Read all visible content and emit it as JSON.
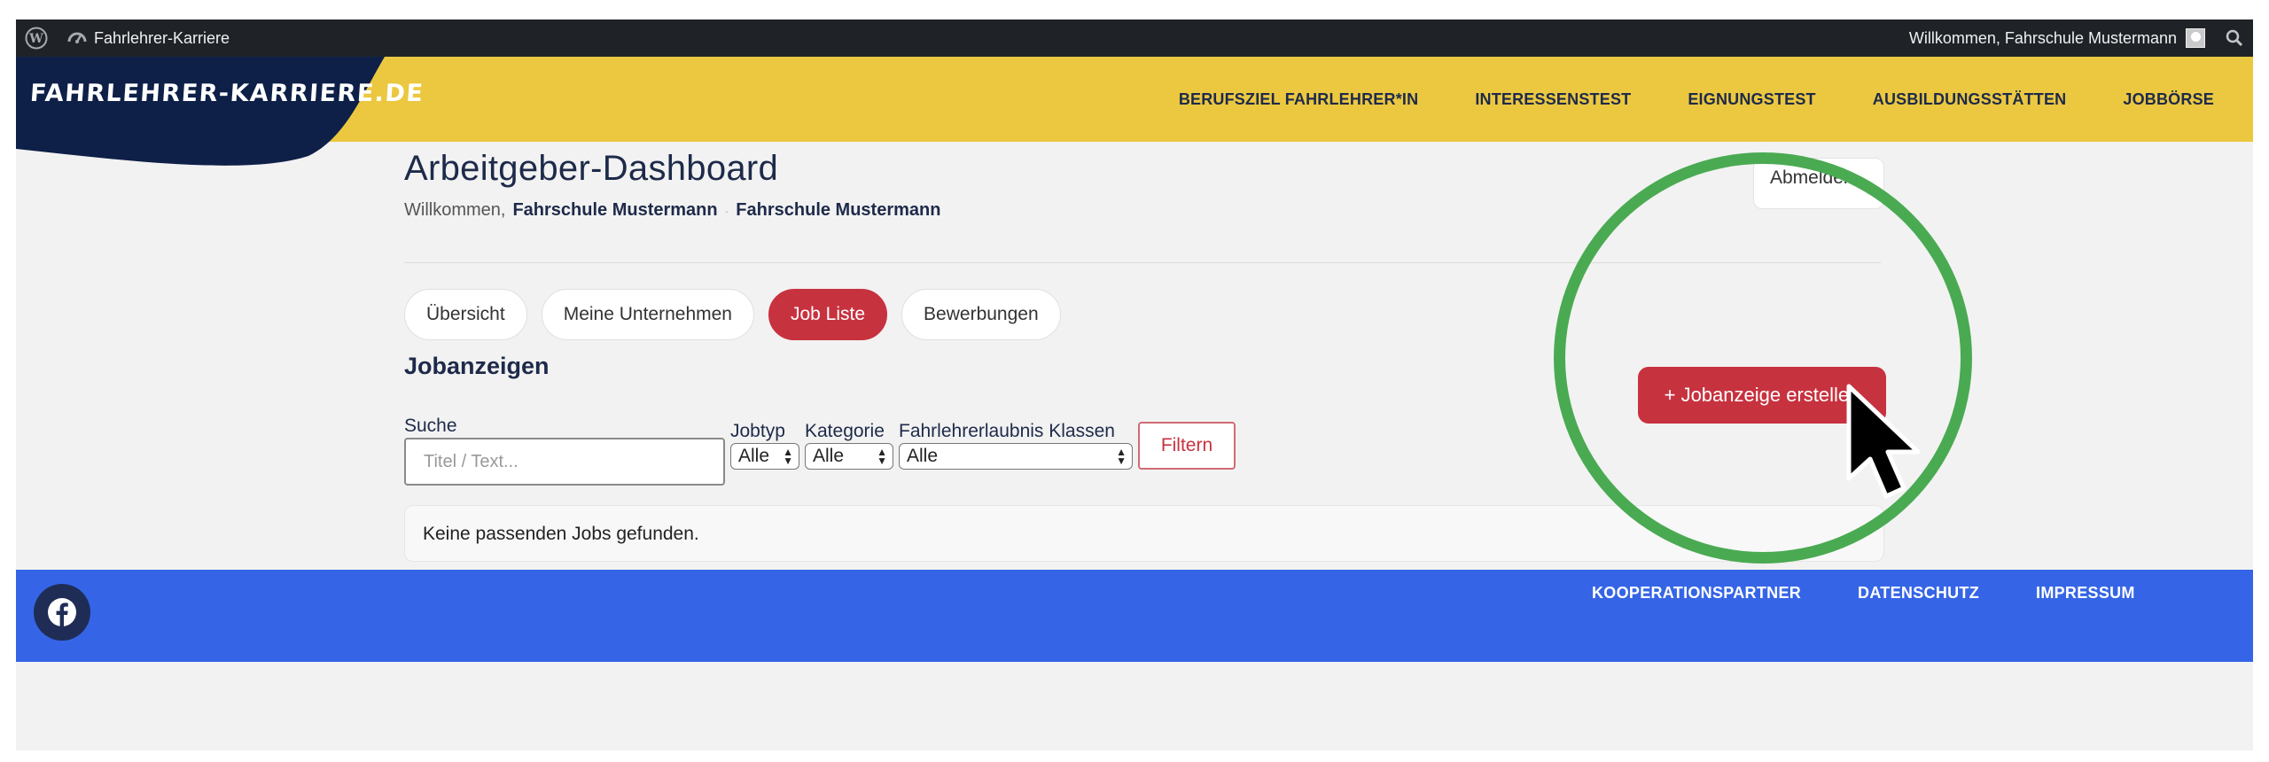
{
  "adminbar": {
    "site_name": "Fahrlehrer-Karriere",
    "greeting": "Willkommen, Fahrschule Mustermann"
  },
  "header": {
    "logo_text": "FAHRLEHRER-KARRIERE.DE",
    "nav": [
      "BERUFSZIEL FAHRLEHRER*IN",
      "INTERESSENSTEST",
      "EIGNUNGSTEST",
      "AUSBILDUNGSSTÄTTEN",
      "JOBBÖRSE"
    ]
  },
  "dashboard": {
    "title": "Arbeitgeber-Dashboard",
    "welcome_prefix": "Willkommen,",
    "user_name": "Fahrschule Mustermann",
    "company_name": "Fahrschule Mustermann",
    "logout_label": "Abmelden",
    "tabs": [
      "Übersicht",
      "Meine Unternehmen",
      "Job Liste",
      "Bewerbungen"
    ],
    "active_tab": "Job Liste",
    "section_title": "Jobanzeigen",
    "create_button": "+ Jobanzeige erstellen"
  },
  "filters": {
    "search_label": "Suche",
    "search_placeholder": "Titel / Text...",
    "jobtyp_label": "Jobtyp",
    "jobtyp_value": "Alle",
    "kategorie_label": "Kategorie",
    "kategorie_value": "Alle",
    "klassen_label": "Fahrlehrerlaubnis Klassen",
    "klassen_value": "Alle",
    "filter_button": "Filtern"
  },
  "results": {
    "empty_message": "Keine passenden Jobs gefunden."
  },
  "footer": {
    "links": [
      "KOOPERATIONSPARTNER",
      "DATENSCHUTZ",
      "IMPRESSUM"
    ]
  },
  "colors": {
    "header_bg": "#ebc840",
    "accent_red": "#c7323f",
    "footer_bg": "#3565e6",
    "highlight_green": "#4aaa52",
    "adminbar_bg": "#1f2327"
  }
}
